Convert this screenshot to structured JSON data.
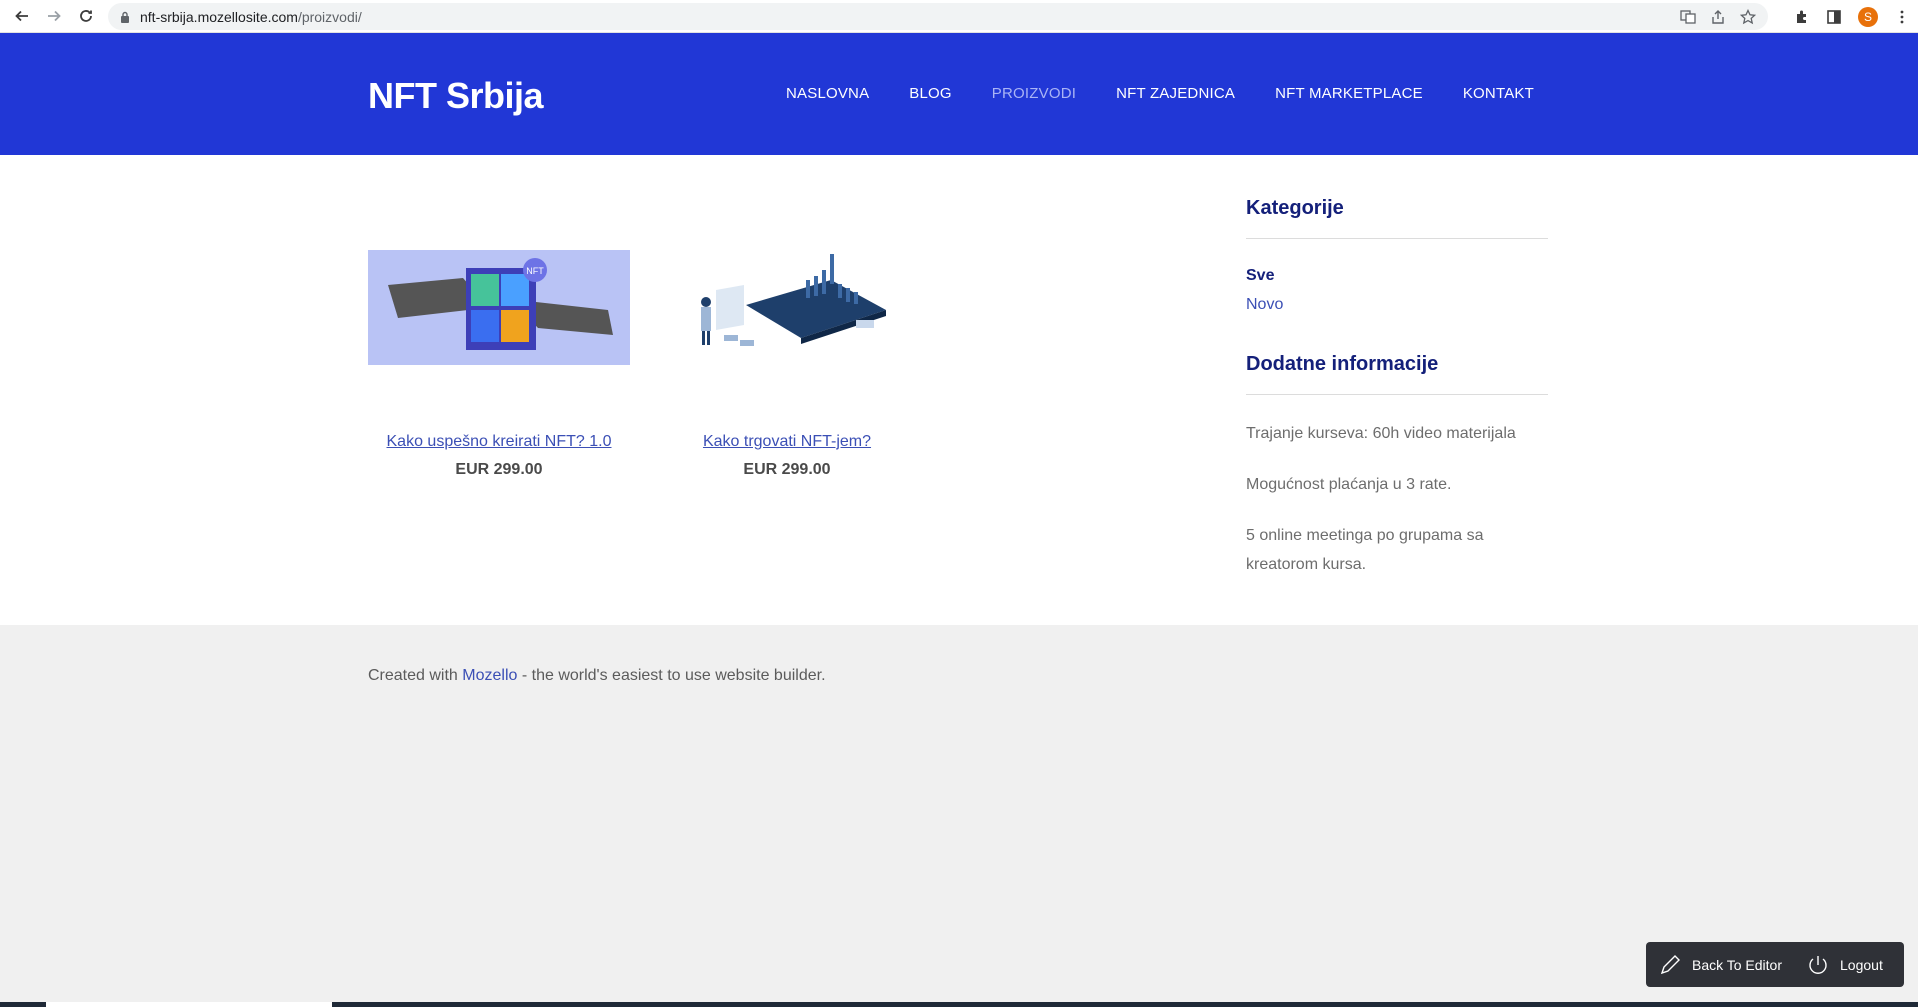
{
  "browser": {
    "url_host": "nft-srbija.mozellosite.com",
    "url_path": "/proizvodi/",
    "avatar_letter": "S"
  },
  "site": {
    "logo": "NFT Srbija",
    "nav": [
      {
        "label": "NASLOVNA",
        "active": false
      },
      {
        "label": "BLOG",
        "active": false
      },
      {
        "label": "PROIZVODI",
        "active": true
      },
      {
        "label": "NFT ZAJEDNICA",
        "active": false
      },
      {
        "label": "NFT MARKETPLACE",
        "active": false
      },
      {
        "label": "KONTAKT",
        "active": false
      }
    ]
  },
  "products": [
    {
      "name": "Kako uspešno kreirati NFT? 1.0",
      "price": "EUR 299.00"
    },
    {
      "name": "Kako trgovati NFT-jem?",
      "price": "EUR 299.00"
    }
  ],
  "sidebar": {
    "categories_title": "Kategorije",
    "categories": [
      {
        "label": "Sve"
      },
      {
        "label": "Novo"
      }
    ],
    "info_title": "Dodatne informacije",
    "info": [
      "Trajanje kurseva: 60h video materijala",
      "Mogućnost plaćanja u 3 rate.",
      "5 online meetinga po grupama sa kreatorom kursa."
    ]
  },
  "footer": {
    "prefix": "Created with ",
    "link": "Mozello",
    "suffix": " - the world's easiest to use website builder."
  },
  "editor": {
    "back_label": "Back To Editor",
    "logout_label": "Logout"
  },
  "colors": {
    "header_bg": "#2137d6",
    "link": "#3b4fb5",
    "heading": "#14207a"
  }
}
